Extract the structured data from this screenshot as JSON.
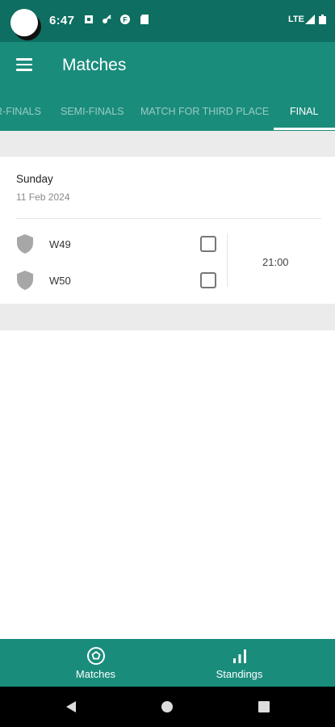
{
  "status_bar": {
    "time": "6:47",
    "network": "LTE",
    "icons": [
      "notification-square-icon",
      "key-icon",
      "app-f-icon",
      "sd-card-icon",
      "signal-icon",
      "battery-icon"
    ]
  },
  "app_bar": {
    "title": "Matches",
    "menu_icon": "hamburger-menu-icon"
  },
  "tabs": [
    {
      "label": "R-FINALS",
      "active": false
    },
    {
      "label": "SEMI-FINALS",
      "active": false
    },
    {
      "label": "MATCH FOR THIRD PLACE",
      "active": false
    },
    {
      "label": "FINAL",
      "active": true
    }
  ],
  "match_group": {
    "day": "Sunday",
    "date": "11 Feb 2024",
    "matches": [
      {
        "home": {
          "name": "W49",
          "icon": "shield-icon",
          "favorite": false
        },
        "away": {
          "name": "W50",
          "icon": "shield-icon",
          "favorite": false
        },
        "time": "21:00"
      }
    ]
  },
  "bottom_nav": [
    {
      "label": "Matches",
      "icon": "soccer-ball-icon",
      "active": true
    },
    {
      "label": "Standings",
      "icon": "bar-chart-icon",
      "active": false
    }
  ],
  "system_nav": [
    "back-icon",
    "home-icon",
    "recents-icon"
  ],
  "colors": {
    "status_bar": "#0d6e61",
    "primary": "#1a8c7b",
    "background": "#ebebeb",
    "card": "#ffffff"
  }
}
